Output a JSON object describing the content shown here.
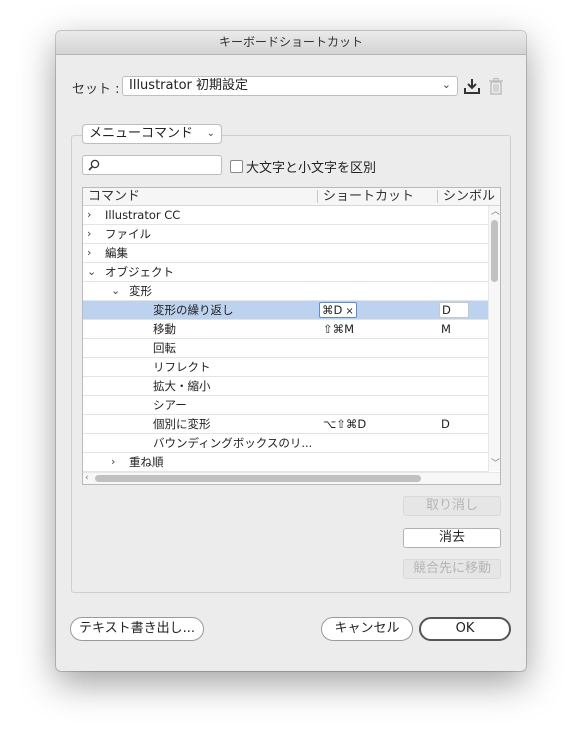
{
  "window": {
    "title": "キーボードショートカット"
  },
  "set": {
    "label": "セット :",
    "value": "Illustrator 初期設定"
  },
  "menu_select": {
    "value": "メニューコマンド"
  },
  "search": {
    "placeholder": ""
  },
  "case_checkbox": {
    "label": "大文字と小文字を区別",
    "checked": false
  },
  "table": {
    "headers": {
      "command": "コマンド",
      "shortcut": "ショートカット",
      "symbol": "シンボル"
    },
    "rows": [
      {
        "indent": 0,
        "expander": "collapsed",
        "command": "Illustrator CC",
        "shortcut": "",
        "symbol": ""
      },
      {
        "indent": 0,
        "expander": "collapsed",
        "command": "ファイル",
        "shortcut": "",
        "symbol": ""
      },
      {
        "indent": 0,
        "expander": "collapsed",
        "command": "編集",
        "shortcut": "",
        "symbol": ""
      },
      {
        "indent": 0,
        "expander": "expanded",
        "command": "オブジェクト",
        "shortcut": "",
        "symbol": ""
      },
      {
        "indent": 1,
        "expander": "expanded",
        "command": "変形",
        "shortcut": "",
        "symbol": ""
      },
      {
        "indent": 2,
        "expander": "none",
        "command": "変形の繰り返し",
        "shortcut": "⌘D",
        "symbol": "D",
        "selected": true,
        "editing": true
      },
      {
        "indent": 2,
        "expander": "none",
        "command": "移動",
        "shortcut": "⇧⌘M",
        "symbol": "M"
      },
      {
        "indent": 2,
        "expander": "none",
        "command": "回転",
        "shortcut": "",
        "symbol": ""
      },
      {
        "indent": 2,
        "expander": "none",
        "command": "リフレクト",
        "shortcut": "",
        "symbol": ""
      },
      {
        "indent": 2,
        "expander": "none",
        "command": "拡大・縮小",
        "shortcut": "",
        "symbol": ""
      },
      {
        "indent": 2,
        "expander": "none",
        "command": "シアー",
        "shortcut": "",
        "symbol": ""
      },
      {
        "indent": 2,
        "expander": "none",
        "command": "個別に変形",
        "shortcut": "⌥⇧⌘D",
        "symbol": "D"
      },
      {
        "indent": 2,
        "expander": "none",
        "command": "バウンディングボックスのリ...",
        "shortcut": "",
        "symbol": ""
      },
      {
        "indent": 1,
        "expander": "collapsed",
        "command": "重ね順",
        "shortcut": "",
        "symbol": ""
      }
    ],
    "clear_glyph": "×"
  },
  "buttons": {
    "undo": "取り消し",
    "clear": "消去",
    "go_to_conflict": "競合先に移動",
    "export_text": "テキスト書き出し...",
    "cancel": "キャンセル",
    "ok": "OK"
  },
  "icons": {
    "save_set": "save-set-icon",
    "delete_set": "trash-icon",
    "search": "magnifier-icon"
  },
  "colors": {
    "selection": "#bcd2ee",
    "focus": "#5a8dd6"
  }
}
